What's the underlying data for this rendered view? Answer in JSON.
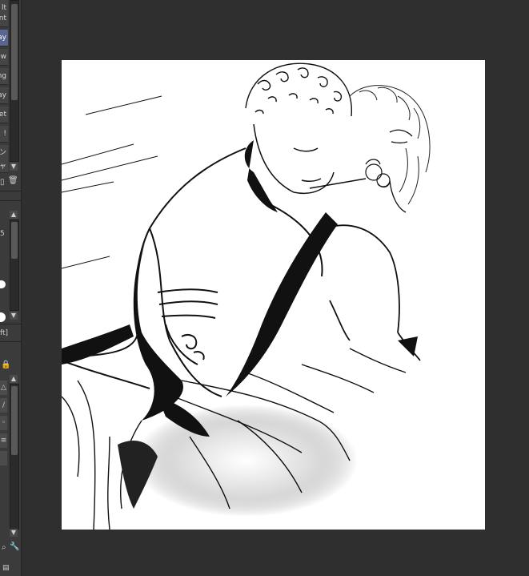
{
  "panel": {
    "menu_items": [
      {
        "label": "lt",
        "active": false
      },
      {
        "label": "nt",
        "active": false
      },
      {
        "label": "ay",
        "active": true
      },
      {
        "label": "ow",
        "active": false
      },
      {
        "label": "ng",
        "active": false
      },
      {
        "label": "ay",
        "active": false
      },
      {
        "label": "et",
        "active": false
      },
      {
        "label": "!",
        "active": false
      },
      {
        "label": "ン",
        "active": false
      },
      {
        "label": "ャ",
        "active": false
      }
    ],
    "value_5": "5",
    "shift_label": "ft]"
  },
  "icons": {
    "trash": "trash-icon",
    "lock": "lock-icon",
    "search": "search-icon",
    "wrench": "wrench-icon"
  },
  "canvas": {
    "description_free": true
  }
}
